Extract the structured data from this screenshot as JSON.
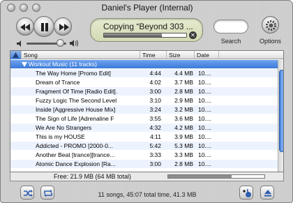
{
  "window": {
    "title": "Daniel's Player (Internal)"
  },
  "transport": {
    "previous_icon": "rewind-icon",
    "play_icon": "pause-icon",
    "next_icon": "fast-forward-icon",
    "volume_level": 0.85
  },
  "lcd": {
    "status_text": "Copying “Beyond 303 ...",
    "progress": 0.7,
    "stop_icon": "stop-circle-x-icon"
  },
  "search": {
    "label": "Search",
    "value": ""
  },
  "options": {
    "label": "Options",
    "icon": "gear-icon"
  },
  "table": {
    "columns": [
      "Song",
      "Time",
      "Size",
      "Date"
    ],
    "group": {
      "label": "Workout Music  (11 tracks)"
    },
    "rows": [
      {
        "song": "The Way Home [Promo Edit]",
        "time": "4:44",
        "size": "4.4 MB",
        "date": "10...."
      },
      {
        "song": "Dream of Trance",
        "time": "4:02",
        "size": "3.7 MB",
        "date": "10...."
      },
      {
        "song": "Fragment Of Time [Radio Edit].",
        "time": "3:00",
        "size": "2.8 MB",
        "date": "10...."
      },
      {
        "song": "Fuzzy Logic The Second Level",
        "time": "3:10",
        "size": "2.9 MB",
        "date": "10...."
      },
      {
        "song": "Inside [Aggressive House Mix]",
        "time": "3:24",
        "size": "3.2 MB",
        "date": "10...."
      },
      {
        "song": "The Sign of Life [Adrenaline F",
        "time": "3:55",
        "size": "3.6 MB",
        "date": "10...."
      },
      {
        "song": "We Are No Strangers",
        "time": "4:32",
        "size": "4.2 MB",
        "date": "10...."
      },
      {
        "song": "This is my HOUSE",
        "time": "4:11",
        "size": "3.9 MB",
        "date": "10...."
      },
      {
        "song": "Addicted - PROMO  [2000-0...",
        "time": "5:42",
        "size": "5.3 MB",
        "date": "10...."
      },
      {
        "song": "Another Beat [trance][trance...",
        "time": "3:33",
        "size": "3.3 MB",
        "date": "10...."
      },
      {
        "song": "Atomic Dance Explosion [Ra...",
        "time": "3:00",
        "size": "2.8 MB",
        "date": "10...."
      }
    ]
  },
  "capacity": {
    "free_text": "Free: 21.9 MB (64 MB total)",
    "used_fraction": 0.66
  },
  "bottom": {
    "shuffle_icon": "shuffle-icon",
    "repeat_icon": "repeat-icon",
    "status_text": "11 songs, 45:07 total time, 41.3 MB",
    "new_playlist_icon": "add-playlist-icon",
    "eject_icon": "eject-icon"
  },
  "colors": {
    "selection_blue": "#3b7ad8",
    "lcd_green": "#dde3c3",
    "row_alt": "#edf3fe"
  }
}
